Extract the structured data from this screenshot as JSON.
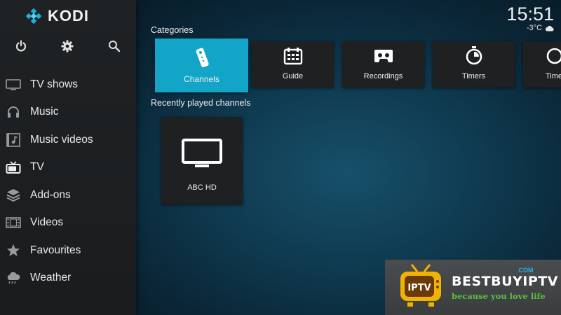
{
  "app": {
    "name": "KODI"
  },
  "clock": {
    "time": "15:51",
    "temperature": "-3°C",
    "weather_icon": "cloud-icon"
  },
  "toolbar": {
    "power_icon": "power-icon",
    "settings_icon": "gear-icon",
    "search_icon": "search-icon"
  },
  "sidebar": {
    "items": [
      {
        "label": "TV shows",
        "icon": "tv-monitor-icon"
      },
      {
        "label": "Music",
        "icon": "headphones-icon"
      },
      {
        "label": "Music videos",
        "icon": "music-video-icon"
      },
      {
        "label": "TV",
        "icon": "retro-tv-icon"
      },
      {
        "label": "Add-ons",
        "icon": "addon-box-icon"
      },
      {
        "label": "Videos",
        "icon": "film-strip-icon"
      },
      {
        "label": "Favourites",
        "icon": "star-icon"
      },
      {
        "label": "Weather",
        "icon": "cloud-icon"
      }
    ],
    "active_index": 3
  },
  "main": {
    "categories_title": "Categories",
    "categories": [
      {
        "label": "Channels",
        "icon": "remote-control-icon",
        "active": true
      },
      {
        "label": "Guide",
        "icon": "calendar-guide-icon"
      },
      {
        "label": "Recordings",
        "icon": "cassette-icon"
      },
      {
        "label": "Timers",
        "icon": "stopwatch-icon"
      },
      {
        "label": "Time",
        "icon": "clock-icon"
      }
    ],
    "recent_title": "Recently played channels",
    "recent_channels": [
      {
        "label": "ABC HD",
        "icon": "tv-monitor-icon"
      }
    ]
  },
  "ad_banner": {
    "badge": "IPTV",
    "brand": "BESTBUYIPTV",
    "domain": ".COM",
    "tagline": "because you love life"
  },
  "colors": {
    "accent": "#13a5c8",
    "sidebar": "#1e2022",
    "background": "#0f3a50",
    "ad_green": "#57c33a",
    "ad_blue": "#1fb6e6"
  }
}
